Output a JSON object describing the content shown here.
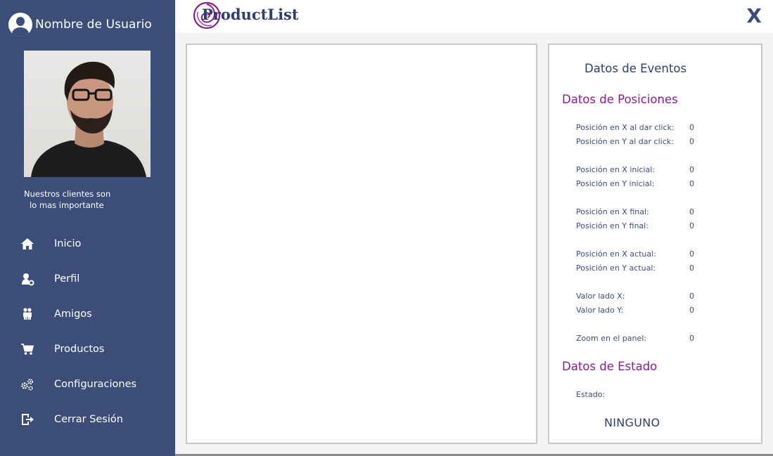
{
  "user": {
    "name": "Nombre de Usuario"
  },
  "tagline": {
    "line1": "Nuestros clientes son",
    "line2": "lo mas importante"
  },
  "nav": [
    {
      "label": "Inicio",
      "icon": "home-icon"
    },
    {
      "label": "Perfil",
      "icon": "profile-settings-icon"
    },
    {
      "label": "Amigos",
      "icon": "friends-icon"
    },
    {
      "label": "Productos",
      "icon": "cart-icon"
    },
    {
      "label": "Configuraciones",
      "icon": "gears-icon"
    },
    {
      "label": "Cerrar Sesión",
      "icon": "logout-icon"
    }
  ],
  "header": {
    "app_title": "ProductList",
    "close_label": "X"
  },
  "events": {
    "title": "Datos de Eventos",
    "positions_title": "Datos de Posiciones",
    "rows": [
      {
        "label": "Posición en X al dar click:",
        "value": "0"
      },
      {
        "label": "Posición en Y al dar click:",
        "value": "0"
      },
      {
        "label": "Posición en X inicial:",
        "value": "0"
      },
      {
        "label": "Posición en Y inicial:",
        "value": "0"
      },
      {
        "label": "Posición en X final:",
        "value": "0"
      },
      {
        "label": "Posición en Y final:",
        "value": "0"
      },
      {
        "label": "Posición en X actual:",
        "value": "0"
      },
      {
        "label": "Posición en Y actual:",
        "value": "0"
      },
      {
        "label": "Valor lado X:",
        "value": "0"
      },
      {
        "label": "Valor lado Y:",
        "value": "0"
      },
      {
        "label": "Zoom en el panel:",
        "value": "0"
      }
    ],
    "state_title": "Datos de Estado",
    "state_label": "Estado:",
    "state_value": "NINGUNO"
  },
  "colors": {
    "sidebar_bg": "#3c4e78",
    "accent_purple": "#8a1c8c",
    "title_navy": "#2f3f6e"
  }
}
